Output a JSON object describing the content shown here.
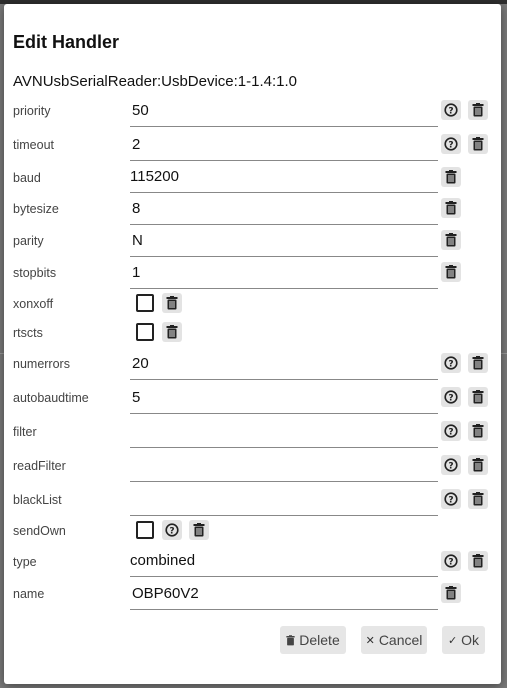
{
  "dialog": {
    "title": "Edit Handler",
    "handler_id": "AVNUsbSerialReader:UsbDevice:1-1.4:1.0"
  },
  "fields": {
    "priority": {
      "label": "priority",
      "value": "50"
    },
    "timeout": {
      "label": "timeout",
      "value": "2"
    },
    "baud": {
      "label": "baud",
      "value": "115200"
    },
    "bytesize": {
      "label": "bytesize",
      "value": "8"
    },
    "parity": {
      "label": "parity",
      "value": "N"
    },
    "stopbits": {
      "label": "stopbits",
      "value": "1"
    },
    "xonxoff": {
      "label": "xonxoff",
      "checked": false
    },
    "rtscts": {
      "label": "rtscts",
      "checked": false
    },
    "numerrors": {
      "label": "numerrors",
      "value": "20"
    },
    "autobaudtime": {
      "label": "autobaudtime",
      "value": "5"
    },
    "filter": {
      "label": "filter",
      "value": ""
    },
    "readFilter": {
      "label": "readFilter",
      "value": ""
    },
    "blackList": {
      "label": "blackList",
      "value": ""
    },
    "sendOwn": {
      "label": "sendOwn",
      "checked": false
    },
    "type": {
      "label": "type",
      "value": "combined"
    },
    "name": {
      "label": "name",
      "value": "OBP60V2"
    }
  },
  "actions": {
    "delete_label": "Delete",
    "cancel_label": "Cancel",
    "ok_label": "Ok"
  },
  "icons": {
    "help": "help-circle-icon",
    "delete": "trash-icon",
    "cancel": "close-icon",
    "ok": "check-icon"
  },
  "colors": {
    "button_bg": "#e3e3e3",
    "overlay_bg": "#7a7a7a",
    "dialog_bg": "#ffffff"
  }
}
